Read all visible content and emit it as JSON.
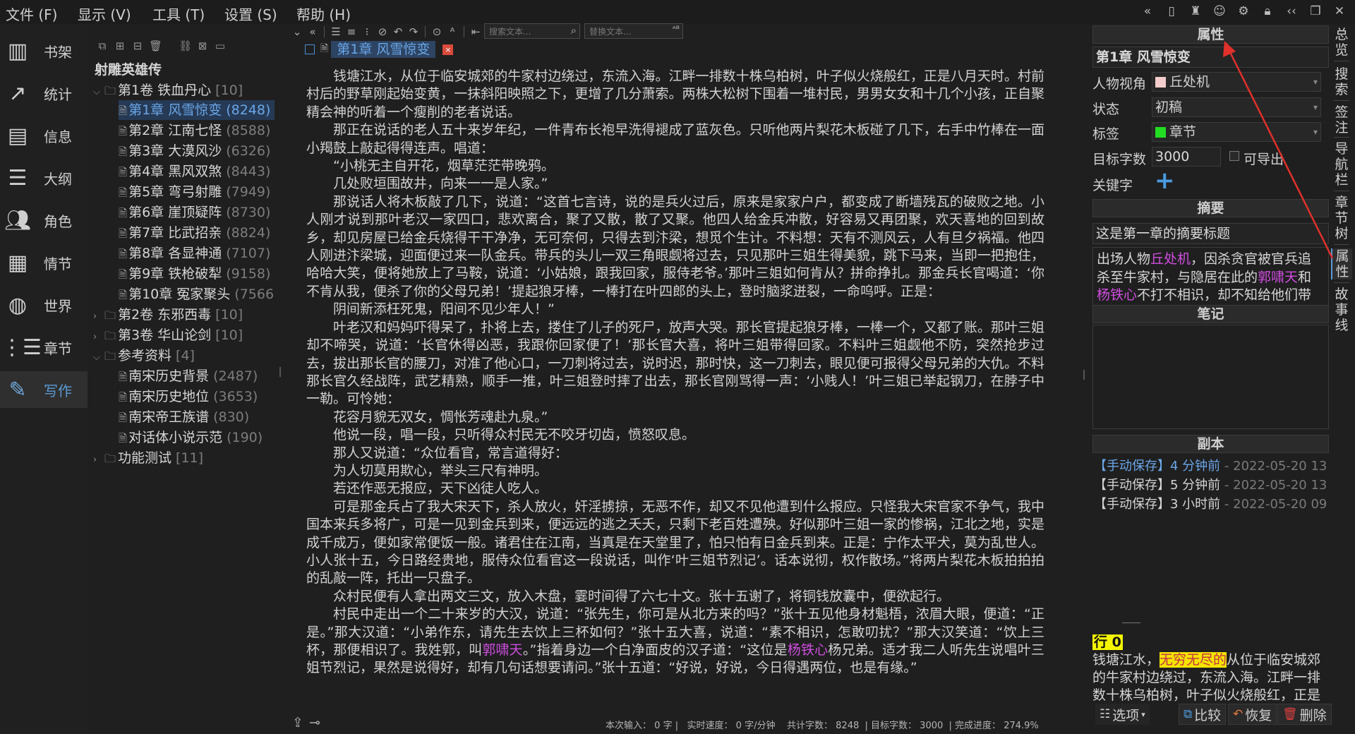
{
  "menu": [
    "文件 (F)",
    "显示 (V)",
    "工具 (T)",
    "设置 (S)",
    "帮助 (H)"
  ],
  "window_icons": [
    "collapse-left-icon",
    "phone-icon",
    "shirt-icon",
    "user-icon",
    "gear-icon",
    "lock-icon",
    "double-chevron-left-icon",
    "restore-icon",
    "close-icon"
  ],
  "nav": [
    {
      "label": "书架",
      "icon": "bookshelf-icon",
      "active": false
    },
    {
      "label": "统计",
      "icon": "stats-icon",
      "active": false
    },
    {
      "label": "信息",
      "icon": "info-icon",
      "active": false
    },
    {
      "label": "大纲",
      "icon": "outline-icon",
      "active": false
    },
    {
      "label": "角色",
      "icon": "characters-icon",
      "active": false
    },
    {
      "label": "情节",
      "icon": "plot-icon",
      "active": false
    },
    {
      "label": "世界",
      "icon": "world-icon",
      "active": false
    },
    {
      "label": "章节",
      "icon": "chapters-icon",
      "active": false
    },
    {
      "label": "写作",
      "icon": "write-icon",
      "active": true
    }
  ],
  "tree": {
    "book_title": "射雕英雄传",
    "volume1": {
      "label": "第1卷 铁血丹心",
      "count": "[10]"
    },
    "chapters": [
      {
        "label": "第1章 风雪惊变",
        "count": "(8248)"
      },
      {
        "label": "第2章 江南七怪",
        "count": "(8588)"
      },
      {
        "label": "第3章 大漠风沙",
        "count": "(6326)"
      },
      {
        "label": "第4章 黑风双煞",
        "count": "(8443)"
      },
      {
        "label": "第5章 弯弓射雕",
        "count": "(7949)"
      },
      {
        "label": "第6章 崖顶疑阵",
        "count": "(8730)"
      },
      {
        "label": "第7章 比武招亲",
        "count": "(8824)"
      },
      {
        "label": "第8章 各显神通",
        "count": "(7107)"
      },
      {
        "label": "第9章 铁枪破犁",
        "count": "(9158)"
      },
      {
        "label": "第10章 冤家聚头",
        "count": "(7566"
      }
    ],
    "volume2": {
      "label": "第2卷 东邪西毒",
      "count": "[10]"
    },
    "volume3": {
      "label": "第3卷 华山论剑",
      "count": "[10]"
    },
    "refs": {
      "label": "参考资料",
      "count": "[4]"
    },
    "ref_items": [
      {
        "label": "南宋历史背景",
        "count": "(2487)"
      },
      {
        "label": "南宋历史地位",
        "count": "(3653)"
      },
      {
        "label": "南宋帝王族谱",
        "count": "(830)"
      },
      {
        "label": "对话体小说示范",
        "count": "(190)"
      }
    ],
    "test": {
      "label": "功能测试",
      "count": "[11]"
    }
  },
  "search": {
    "find_placeholder": "搜索文本...",
    "replace_placeholder": "替换文本..."
  },
  "tab": {
    "title": "第1章 风雪惊变",
    "close": "×"
  },
  "editor": {
    "p1": "钱塘江水，从位于临安城郊的牛家村边绕过，东流入海。江畔一排数十株乌柏树，叶子似火烧般红，正是八月天时。村前村后的野草刚起始变黄，一抹斜阳映照之下，更增了几分萧索。两株大松树下围着一堆村民，男男女女和十几个小孩，正自聚精会神的听着一个瘦削的老者说话。",
    "p2": "那正在说话的老人五十来岁年纪，一件青布长袍早洗得褪成了蓝灰色。只听他两片梨花木板碰了几下，右手中竹棒在一面小羯鼓上敲起得得连声。唱道：",
    "p3": "“小桃无主自开花，烟草茫茫带晚鸦。",
    "p4": "几处败垣围故井，向来一一是人家。”",
    "p5": "那说话人将木板敲了几下，说道：“这首七言诗，说的是兵火过后，原来是家家户户，都变成了断墙残瓦的破败之地。小人刚才说到那叶老汉一家四口，悲欢离合，聚了又散，散了又聚。他四人给金兵冲散，好容易又再团聚，欢天喜地的回到故乡，却见房屋已给金兵烧得干干净净，无可奈何，只得去到汴梁，想觅个生计。不料想：天有不测风云，人有旦夕祸福。他四人刚进汴梁城，迎面便过来一队金兵。带兵的头儿一双三角眼觑将过去，只见那叶三姐生得美貌，跳下马来，当即一把抱住，哈哈大笑，便将她放上了马鞍，说道：‘小姑娘，跟我回家，服侍老爷。’那叶三姐如何肯从？拼命挣扎。那金兵长官喝道：‘你不肯从我，便杀了你的父母兄弟！’提起狼牙棒，一棒打在叶四郎的头上，登时脑浆迸裂，一命呜呼。正是：",
    "p6": "阴间新添枉死鬼，阳间不见少年人！”",
    "p7": "叶老汉和妈妈吓得呆了，扑将上去，搂住了儿子的死尸，放声大哭。那长官提起狼牙棒，一棒一个，又都了账。那叶三姐却不啼哭，说道：‘长官休得凶恶，我跟你回家便了！’那长官大喜，将叶三姐带得回家。不料叶三姐觑他不防，突然抢步过去，拔出那长官的腰刀，对准了他心口，一刀刺将过去，说时迟，那时快，这一刀刺去，眼见便可报得父母兄弟的大仇。不料那长官久经战阵，武艺精熟，顺手一推，叶三姐登时摔了出去，那长官刚骂得一声：‘小贱人！’叶三姐已举起钢刀，在脖子中一勒。可怜她：",
    "p8": "花容月貌无双女，惆怅芳魂赴九泉。”",
    "p9": "他说一段，唱一段，只听得众村民无不咬牙切齿，愤怒叹息。",
    "p10": "那人又说道：“众位看官，常言道得好：",
    "p11": "为人切莫用欺心，举头三尺有神明。",
    "p12": "若还作恶无报应，天下凶徒人吃人。",
    "p13": "可是那金兵占了我大宋天下，杀人放火，奸淫掳掠，无恶不作，却又不见他遭到什么报应。只怪我大宋官家不争气，我中国本来兵多将广，可是一见到金兵到来，便远远的逃之夭夭，只剩下老百姓遭殃。好似那叶三姐一家的惨祸，江北之地，实是成千成万，便如家常便饭一般。诸君住在江南，当真是在天堂里了，怕只怕有日金兵到来。正是：宁作太平犬，莫为乱世人。小人张十五，今日路经贵地，服侍众位看官这一段说话，叫作‘叶三姐节烈记’。话本说彻，权作散场。”将两片梨花木板拍拍拍的乱敲一阵，托出一只盘子。",
    "p14": "众村民便有人拿出两文三文，放入木盘，霎时间得了六七十文。张十五谢了，将铜钱放囊中，便欲起行。",
    "p15_a": "村民中走出一个二十来岁的大汉，说道：“张先生，你可是从北方来的吗？”张十五见他身材魁梧，浓眉大眼，便道：“正是。”那大汉道：“小弟作东，请先生去饮上三杯如何？”张十五大喜，说道：“素不相识，怎敢叨扰？”那大汉笑道：“饮上三杯，那便相识了。我姓郭，叫",
    "p15_name1": "郭啸天",
    "p15_b": "。”指着身边一个白净面皮的汉子道：“这位是",
    "p15_name2": "杨铁心",
    "p15_c": "杨兄弟。适才我二人听先生说唱叶三姐节烈记，果然是说得好，却有几句话想要请问。”张十五道：“好说，好说，今日得遇两位，也是有缘。”"
  },
  "status": {
    "input_label": "本次输入：",
    "input_value": "0",
    "input_unit": "字 |",
    "speed_label": "实时速度：",
    "speed_value": "0",
    "speed_unit": "字/分钟",
    "total_label": "共计字数：",
    "total_value": "8248",
    "target_label": "| 目标字数：",
    "target_value": "3000",
    "progress_label": "| 完成进度：",
    "progress_value": "274.9%"
  },
  "props": {
    "header": "属性",
    "chapter_title": "第1章 风雪惊变",
    "pov_label": "人物视角",
    "pov_value": "丘处机",
    "pov_color": "#f4cccc",
    "state_label": "状态",
    "state_value": "初稿",
    "tag_label": "标签",
    "tag_value": "章节",
    "tag_color": "#22dd22",
    "target_label": "目标字数",
    "target_value": "3000",
    "exportable_label": "可导出",
    "exportable_checked": false,
    "keyword_label": "关键字"
  },
  "summary": {
    "header": "摘要",
    "title": "这是第一章的摘要标题",
    "text_a": "出场人物",
    "name1": "丘处机",
    "text_b": "，因杀贪官被官兵追杀至牛家村，与隐居在此的",
    "name2": "郭啸天",
    "text_c": "和",
    "name3": "杨铁心",
    "text_d": "不打不相识，却不知给他们带来了杀身之祸。"
  },
  "notes": {
    "header": "笔记"
  },
  "copies": {
    "header": "副本",
    "items": [
      {
        "tag": "【手动保存】",
        "time": "4 分钟前",
        "date": "- 2022-05-20 13",
        "active": true
      },
      {
        "tag": "【手动保存】",
        "time": "5 分钟前",
        "date": "- 2022-05-20 13",
        "active": false
      },
      {
        "tag": "【手动保存】",
        "time": "3 小时前",
        "date": "- 2022-05-20 09",
        "active": false
      }
    ]
  },
  "line_info": {
    "tag": "行 0",
    "text_a": "钱塘江水，",
    "highlight": "无穷无尽的",
    "text_b": "从位于临安城郊的牛家村边绕过，东流入海。江畔一排数十株乌柏树，叶子似火烧般红，正是"
  },
  "bottom_buttons": {
    "options": "选项",
    "compare": "比较",
    "restore": "恢复",
    "delete": "删除"
  },
  "vtabs": [
    "总览",
    "搜索",
    "签注",
    "导航栏",
    "章节树",
    "属性",
    "故事线"
  ],
  "colors": {
    "accent": "#5b9bd5",
    "selection": "#263a55",
    "annotation_arrow": "#e0312b",
    "name_highlight": "#d04de0"
  }
}
